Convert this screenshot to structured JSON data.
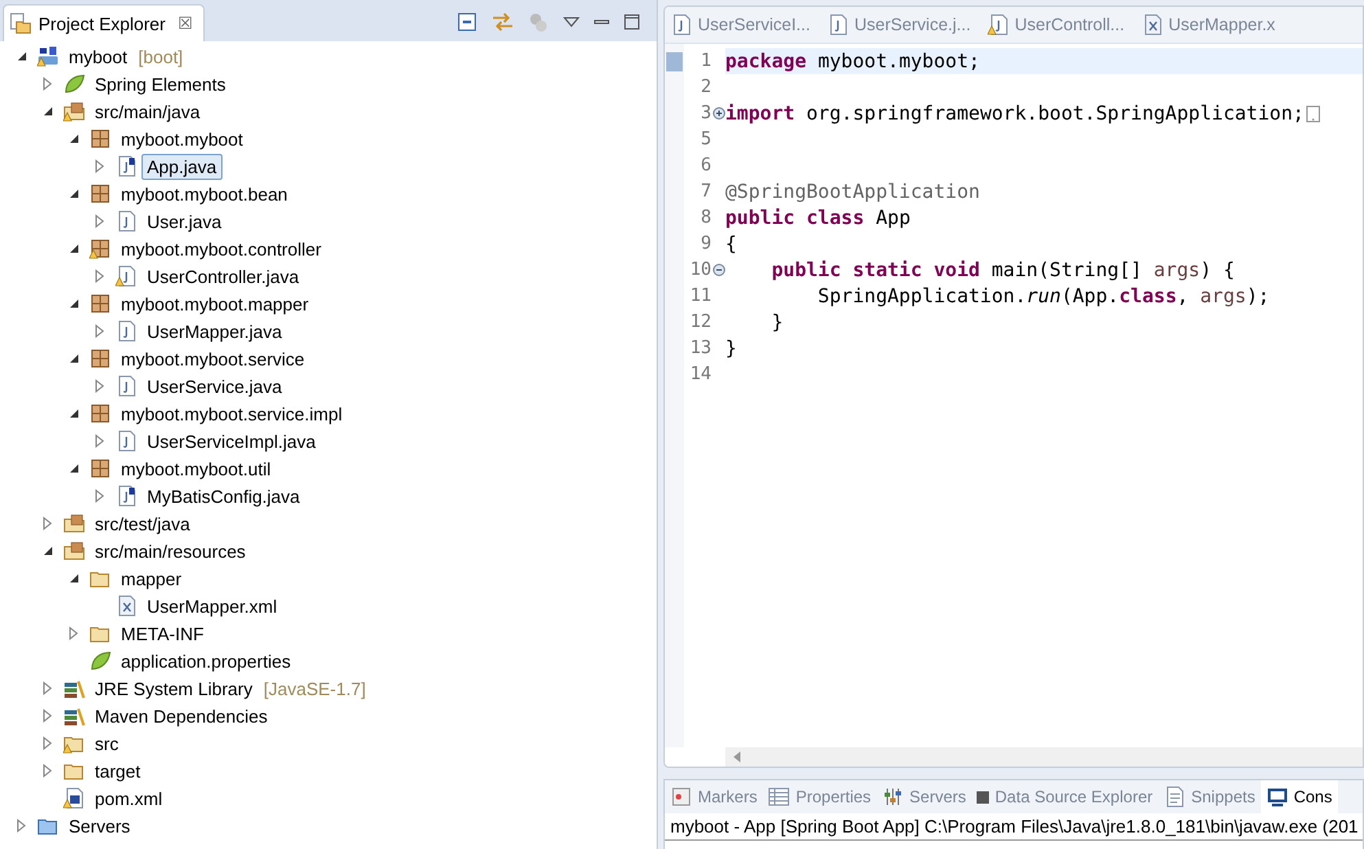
{
  "explorer": {
    "title": "Project Explorer",
    "close": "☒",
    "tree": [
      {
        "label": "myboot",
        "suffix": "[boot]",
        "kind": "project",
        "expanded": true,
        "selected": false,
        "children": [
          {
            "label": "Spring Elements",
            "kind": "spring",
            "expanded": false,
            "selected": false
          },
          {
            "label": "src/main/java",
            "kind": "srcfolder-warn",
            "expanded": true,
            "selected": false,
            "children": [
              {
                "label": "myboot.myboot",
                "kind": "package",
                "expanded": true,
                "selected": false,
                "children": [
                  {
                    "label": "App.java",
                    "kind": "java-spring",
                    "expanded": false,
                    "selected": true
                  }
                ]
              },
              {
                "label": "myboot.myboot.bean",
                "kind": "package",
                "expanded": true,
                "selected": false,
                "children": [
                  {
                    "label": "User.java",
                    "kind": "java",
                    "expanded": false,
                    "selected": false
                  }
                ]
              },
              {
                "label": "myboot.myboot.controller",
                "kind": "package-warn",
                "expanded": true,
                "selected": false,
                "children": [
                  {
                    "label": "UserController.java",
                    "kind": "java-warn",
                    "expanded": false,
                    "selected": false
                  }
                ]
              },
              {
                "label": "myboot.myboot.mapper",
                "kind": "package",
                "expanded": true,
                "selected": false,
                "children": [
                  {
                    "label": "UserMapper.java",
                    "kind": "java",
                    "expanded": false,
                    "selected": false
                  }
                ]
              },
              {
                "label": "myboot.myboot.service",
                "kind": "package",
                "expanded": true,
                "selected": false,
                "children": [
                  {
                    "label": "UserService.java",
                    "kind": "java",
                    "expanded": false,
                    "selected": false
                  }
                ]
              },
              {
                "label": "myboot.myboot.service.impl",
                "kind": "package",
                "expanded": true,
                "selected": false,
                "children": [
                  {
                    "label": "UserServiceImpl.java",
                    "kind": "java",
                    "expanded": false,
                    "selected": false
                  }
                ]
              },
              {
                "label": "myboot.myboot.util",
                "kind": "package",
                "expanded": true,
                "selected": false,
                "children": [
                  {
                    "label": "MyBatisConfig.java",
                    "kind": "java-spring",
                    "expanded": false,
                    "selected": false
                  }
                ]
              }
            ]
          },
          {
            "label": "src/test/java",
            "kind": "srcfolder",
            "expanded": false,
            "selected": false
          },
          {
            "label": "src/main/resources",
            "kind": "srcfolder",
            "expanded": true,
            "selected": false,
            "children": [
              {
                "label": "mapper",
                "kind": "folder",
                "expanded": true,
                "selected": false,
                "children": [
                  {
                    "label": "UserMapper.xml",
                    "kind": "xml",
                    "selected": false
                  }
                ]
              },
              {
                "label": "META-INF",
                "kind": "folder",
                "expanded": false,
                "selected": false
              },
              {
                "label": "application.properties",
                "kind": "spring",
                "selected": false
              }
            ]
          },
          {
            "label": "JRE System Library",
            "suffix": "[JavaSE-1.7]",
            "kind": "library",
            "expanded": false,
            "selected": false
          },
          {
            "label": "Maven Dependencies",
            "kind": "library",
            "expanded": false,
            "selected": false
          },
          {
            "label": "src",
            "kind": "folder-warn",
            "expanded": false,
            "selected": false
          },
          {
            "label": "target",
            "kind": "folder",
            "expanded": false,
            "selected": false
          },
          {
            "label": "pom.xml",
            "kind": "pom",
            "selected": false
          }
        ]
      },
      {
        "label": "Servers",
        "kind": "folder-blue",
        "expanded": false,
        "selected": false
      }
    ]
  },
  "editor": {
    "tabs": [
      {
        "label": "UserServiceI...",
        "kind": "java"
      },
      {
        "label": "UserService.j...",
        "kind": "java"
      },
      {
        "label": "UserControll...",
        "kind": "java-warn"
      },
      {
        "label": "UserMapper.x",
        "kind": "xml"
      }
    ],
    "lines": [
      {
        "n": "1",
        "current": true,
        "tokens": [
          {
            "t": "package",
            "kind": "kw"
          },
          {
            "t": " myboot.myboot;",
            "kind": "plain"
          }
        ]
      },
      {
        "n": "2",
        "current": false
      },
      {
        "n": "3",
        "current": false,
        "folded": true,
        "tokens": [
          {
            "t": "import",
            "kind": "kw"
          },
          {
            "t": " org.springframework.boot.SpringApplication;",
            "kind": "plain"
          }
        ]
      },
      {
        "n": "5",
        "current": false
      },
      {
        "n": "6",
        "current": false
      },
      {
        "n": "7",
        "current": false,
        "tokens": [
          {
            "t": "@SpringBootApplication",
            "kind": "annotation"
          }
        ]
      },
      {
        "n": "8",
        "current": false,
        "tokens": [
          {
            "t": "public class",
            "kind": "kw"
          },
          {
            "t": " App",
            "kind": "plain"
          }
        ]
      },
      {
        "n": "9",
        "current": false,
        "tokens": [
          {
            "t": "{",
            "kind": "plain"
          }
        ]
      },
      {
        "n": "10",
        "current": false,
        "folded": false,
        "tokens": [
          {
            "t": "    public static void",
            "kind": "kw"
          },
          {
            "t": " main(String[] ",
            "kind": "plain"
          },
          {
            "t": "args",
            "kind": "var"
          },
          {
            "t": ") {",
            "kind": "plain"
          }
        ]
      },
      {
        "n": "11",
        "current": false,
        "tokens": [
          {
            "t": "        SpringApplication.",
            "kind": "plain"
          },
          {
            "t": "run",
            "kind": "italic"
          },
          {
            "t": "(App.",
            "kind": "plain"
          },
          {
            "t": "class",
            "kind": "kw"
          },
          {
            "t": ", ",
            "kind": "plain"
          },
          {
            "t": "args",
            "kind": "var"
          },
          {
            "t": ");",
            "kind": "plain"
          }
        ]
      },
      {
        "n": "12",
        "current": false,
        "tokens": [
          {
            "t": "    }",
            "kind": "plain"
          }
        ]
      },
      {
        "n": "13",
        "current": false,
        "tokens": [
          {
            "t": "}",
            "kind": "plain"
          }
        ]
      },
      {
        "n": "14",
        "current": false
      }
    ]
  },
  "bottom": {
    "tabs": [
      {
        "label": "Markers",
        "kind": "markers",
        "selected": false
      },
      {
        "label": "Properties",
        "kind": "properties",
        "selected": false
      },
      {
        "label": "Servers",
        "kind": "servers",
        "selected": false
      },
      {
        "label": "Data Source Explorer",
        "kind": "square",
        "selected": false
      },
      {
        "label": "Snippets",
        "kind": "snippets",
        "selected": false
      },
      {
        "label": "Cons",
        "kind": "console",
        "selected": true
      }
    ],
    "console_title": "myboot - App [Spring Boot App] C:\\Program Files\\Java\\jre1.8.0_181\\bin\\javaw.exe (201"
  }
}
